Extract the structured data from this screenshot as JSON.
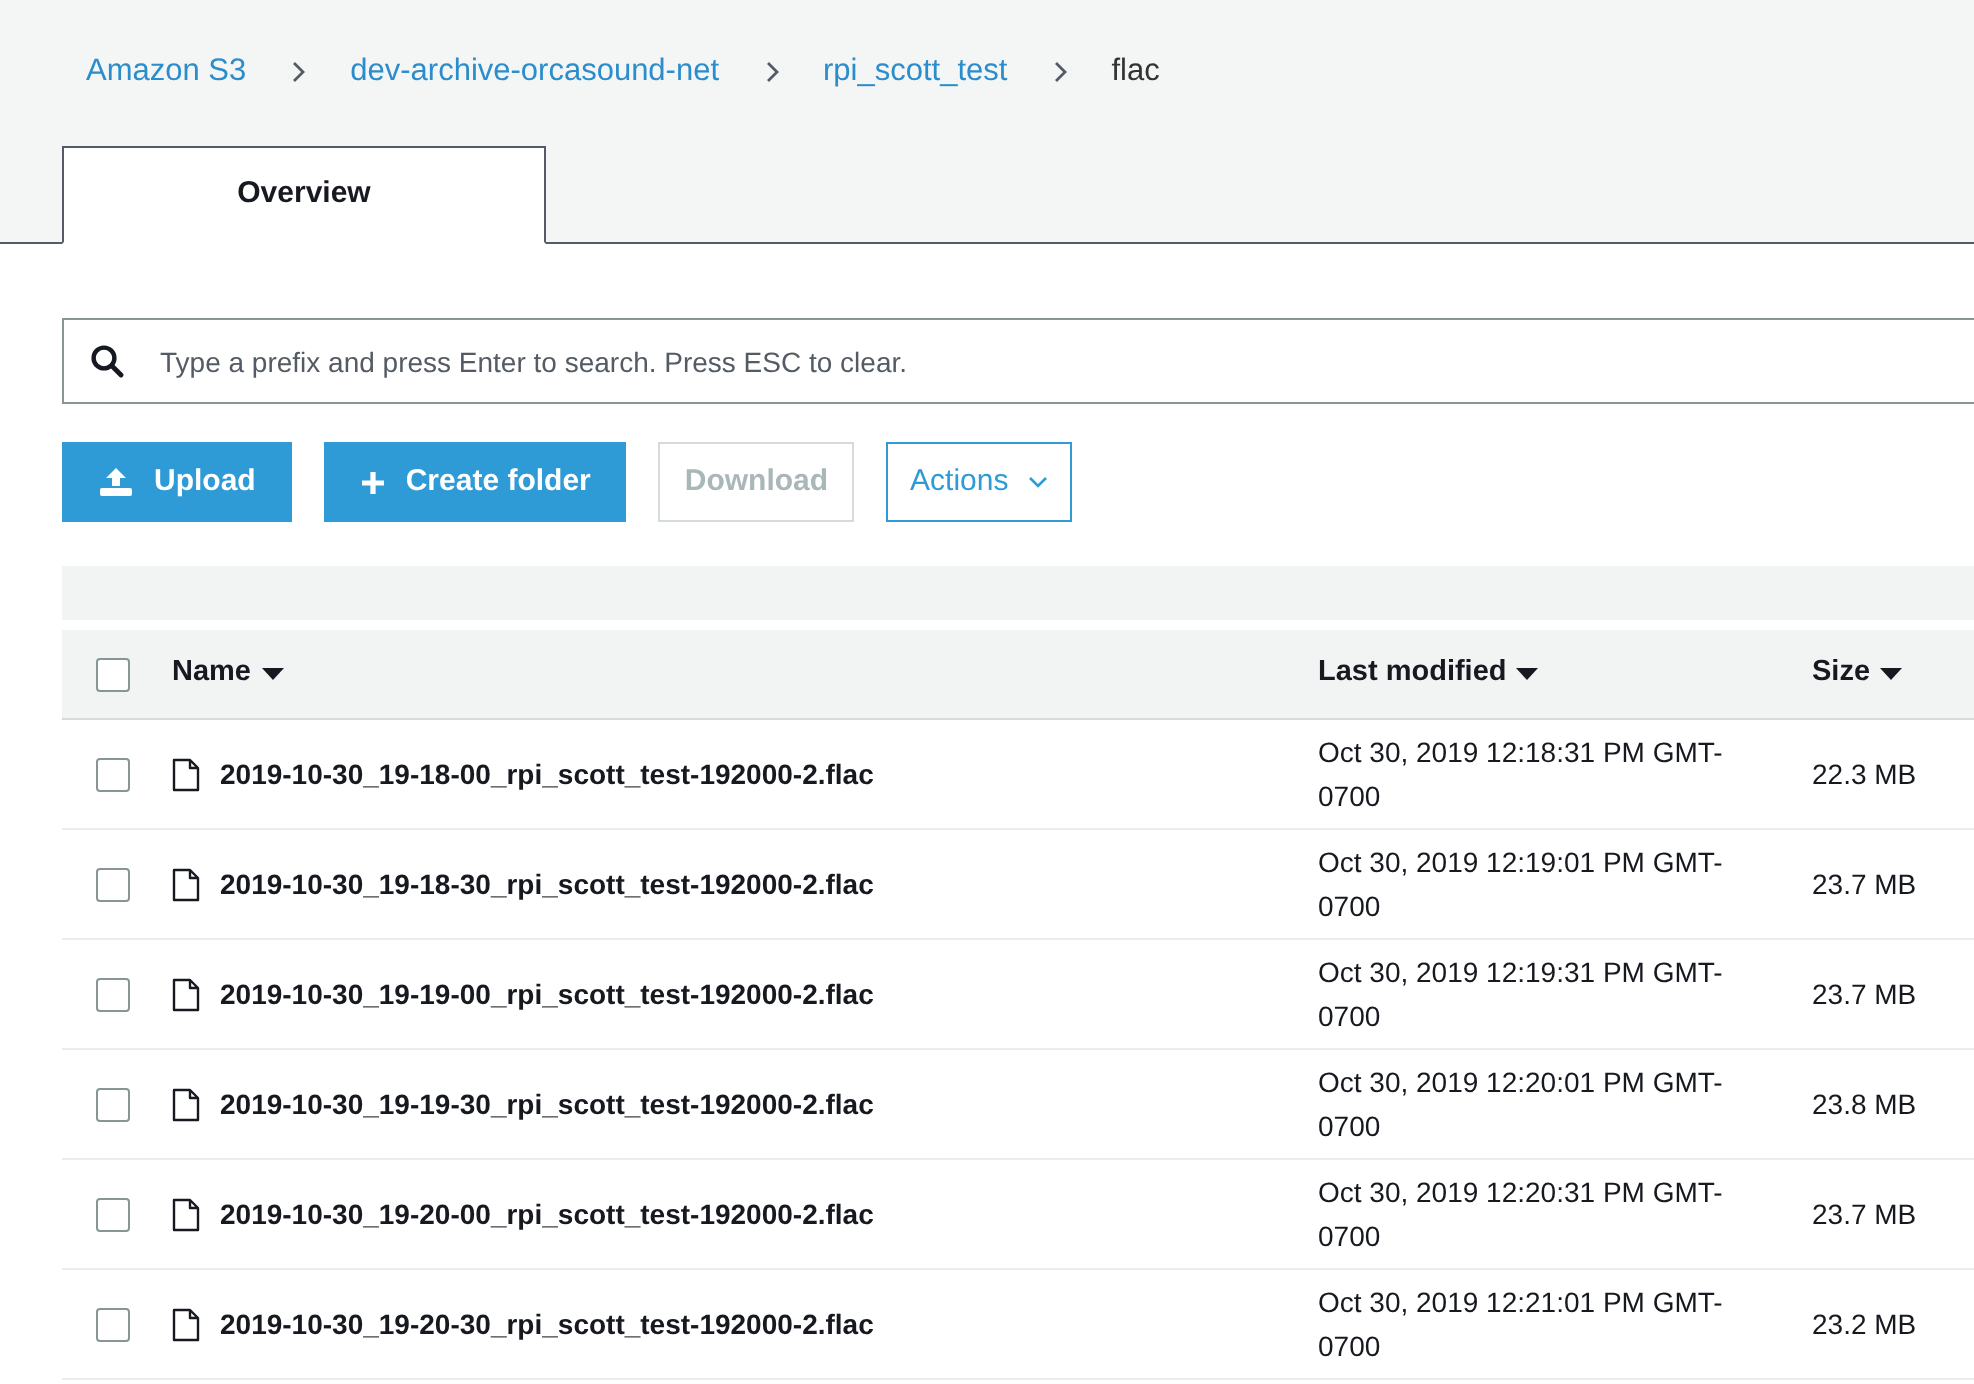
{
  "breadcrumb": [
    {
      "label": "Amazon S3",
      "kind": "link"
    },
    {
      "label": "dev-archive-orcasound-net",
      "kind": "link"
    },
    {
      "label": "rpi_scott_test",
      "kind": "link"
    },
    {
      "label": "flac",
      "kind": "current"
    }
  ],
  "tabs": [
    {
      "label": "Overview",
      "selected": true
    }
  ],
  "search": {
    "placeholder": "Type a prefix and press Enter to search. Press ESC to clear."
  },
  "buttons": [
    {
      "label": "Upload",
      "kind": "upload",
      "disabled": false
    },
    {
      "label": "Create folder",
      "kind": "create",
      "disabled": false
    },
    {
      "label": "Download",
      "kind": "plain",
      "disabled": true
    },
    {
      "label": "Actions",
      "kind": "dropdown",
      "disabled": false
    }
  ],
  "table": {
    "select_all": {
      "checked": false
    },
    "columns": [
      "Name",
      "Last modified",
      "Size"
    ],
    "rows": [
      {
        "checked": false,
        "name": "2019-10-30_19-18-00_rpi_scott_test-192000-2.flac",
        "modified": "Oct 30, 2019 12:18:31 PM GMT-0700",
        "size": "22.3 MB"
      },
      {
        "checked": false,
        "name": "2019-10-30_19-18-30_rpi_scott_test-192000-2.flac",
        "modified": "Oct 30, 2019 12:19:01 PM GMT-0700",
        "size": "23.7 MB"
      },
      {
        "checked": false,
        "name": "2019-10-30_19-19-00_rpi_scott_test-192000-2.flac",
        "modified": "Oct 30, 2019 12:19:31 PM GMT-0700",
        "size": "23.7 MB"
      },
      {
        "checked": false,
        "name": "2019-10-30_19-19-30_rpi_scott_test-192000-2.flac",
        "modified": "Oct 30, 2019 12:20:01 PM GMT-0700",
        "size": "23.8 MB"
      },
      {
        "checked": false,
        "name": "2019-10-30_19-20-00_rpi_scott_test-192000-2.flac",
        "modified": "Oct 30, 2019 12:20:31 PM GMT-0700",
        "size": "23.7 MB"
      },
      {
        "checked": false,
        "name": "2019-10-30_19-20-30_rpi_scott_test-192000-2.flac",
        "modified": "Oct 30, 2019 12:21:01 PM GMT-0700",
        "size": "23.2 MB"
      }
    ]
  }
}
